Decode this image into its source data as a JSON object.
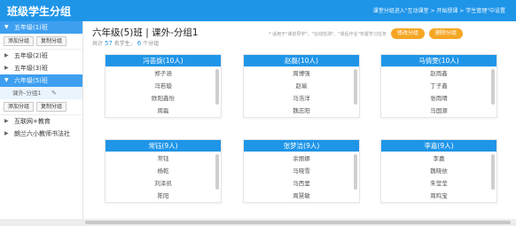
{
  "header": {
    "app_title": "班级学生分组",
    "hint": "课堂分组进入\"互动课堂 > 开始授课 > 学生管理\"中设置"
  },
  "sidebar": {
    "grades": [
      {
        "label": "五年级(1)班",
        "expanded": true
      },
      {
        "label": "五年级(2)班",
        "expanded": false
      },
      {
        "label": "五年级(3)班",
        "expanded": false
      },
      {
        "label": "六年级(5)班",
        "expanded": true
      },
      {
        "label": "互联网+教育",
        "expanded": false
      },
      {
        "label": "朗兰六小教师书法社",
        "expanded": false
      }
    ],
    "add_group": "添加分组",
    "copy_group": "复制分组",
    "subitem": "课外-分组1"
  },
  "main": {
    "title": "六年级(5)班 | 课外-分组1",
    "stats_prefix": "共计",
    "student_count": "57",
    "stats_mid": "名学生，",
    "group_count": "6",
    "stats_suffix": "个分组",
    "note": "* 适用于\"课前导学\"、\"在线检测\"、\"课后作业\"布置学习任务",
    "edit_button": "修改分组",
    "delete_button": "删除分组"
  },
  "groups": [
    {
      "name": "冯荟旋(10人)",
      "members": [
        "郑子涵",
        "冯若璇",
        "欧阳鑫怡",
        "周磊"
      ]
    },
    {
      "name": "赵磊(10人)",
      "members": [
        "周博强",
        "赵瑜",
        "马浩洋",
        "魏志阳"
      ]
    },
    {
      "name": "马倩雯(10人)",
      "members": [
        "赵雨鑫",
        "丁子鑫",
        "张雨晴",
        "马国源"
      ]
    },
    {
      "name": "常钰(9人)",
      "members": [
        "常钰",
        "杨乾",
        "刘泽凯",
        "陈阳"
      ]
    },
    {
      "name": "张梦洁(9人)",
      "members": [
        "余丽娜",
        "马晓雪",
        "马西里",
        "周慧敏"
      ]
    },
    {
      "name": "李嘉(9人)",
      "members": [
        "李嘉",
        "魏晓依",
        "朱莹莹",
        "周鸣宝"
      ]
    }
  ]
}
